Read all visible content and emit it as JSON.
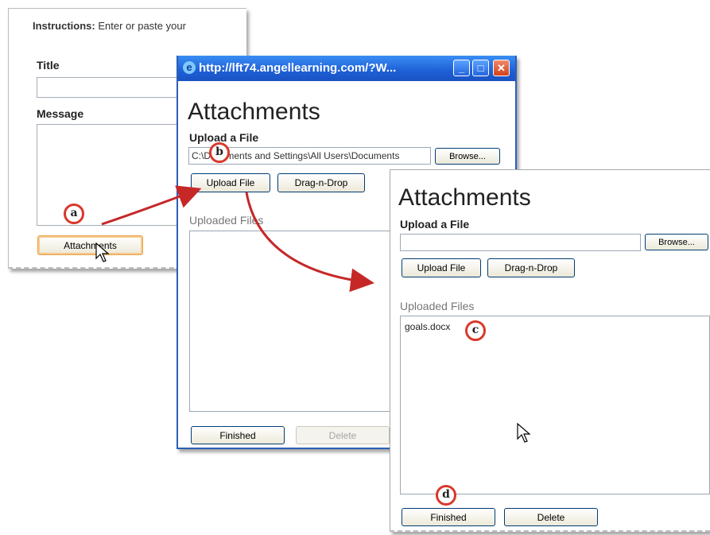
{
  "panel1": {
    "instructions_label": "Instructions:",
    "instructions_text": "Enter or paste your",
    "title_label": "Title",
    "message_label": "Message",
    "attachments_button": "Attachments"
  },
  "popup": {
    "url": "http://lft74.angellearning.com/?W...",
    "heading": "Attachments",
    "upload_label": "Upload a File",
    "file_path": "C:\\Documents and Settings\\All Users\\Documents",
    "browse": "Browse...",
    "upload_button": "Upload File",
    "drag_drop_button": "Drag-n-Drop",
    "uploaded_label": "Uploaded Files",
    "finished_button": "Finished",
    "delete_button": "Delete"
  },
  "panel3": {
    "heading": "Attachments",
    "upload_label": "Upload a File",
    "browse": "Browse...",
    "upload_button": "Upload File",
    "drag_drop_button": "Drag-n-Drop",
    "uploaded_label": "Uploaded Files",
    "file_item": "goals.docx",
    "finished_button": "Finished",
    "delete_button": "Delete"
  },
  "callouts": {
    "a": "a",
    "b": "b",
    "c": "c",
    "d": "d"
  },
  "colors": {
    "arrow": "#c62828",
    "callout_ring": "#d9382b",
    "titlebar": "#1e5fd6"
  }
}
